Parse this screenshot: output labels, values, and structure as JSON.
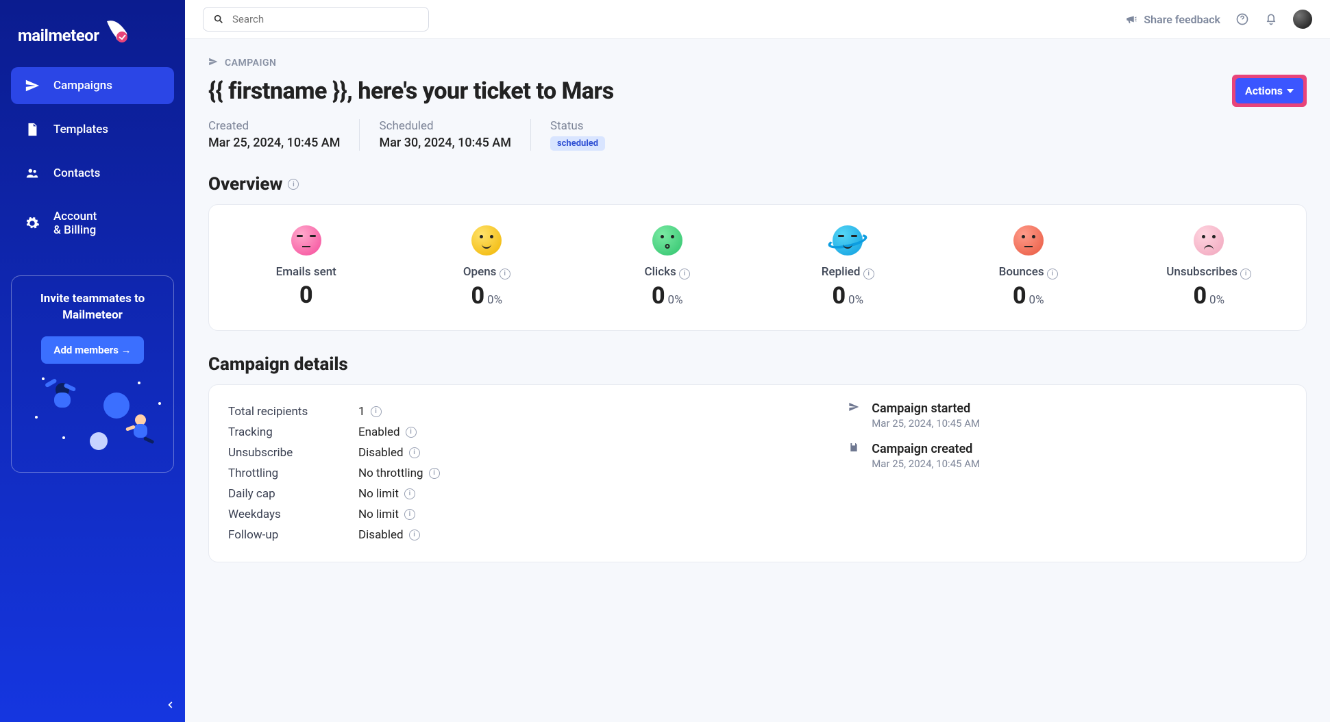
{
  "brand": "mailmeteor",
  "sidebar": {
    "items": [
      {
        "label": "Campaigns"
      },
      {
        "label": "Templates"
      },
      {
        "label": "Contacts"
      },
      {
        "label_l1": "Account",
        "label_l2": "& Billing"
      }
    ],
    "invite": {
      "title_l1": "Invite teammates to",
      "title_l2": "Mailmeteor",
      "cta": "Add members →"
    }
  },
  "topbar": {
    "search_placeholder": "Search",
    "share": "Share feedback"
  },
  "crumb": "CAMPAIGN",
  "title": "{{ firstname }}, here's your ticket to Mars",
  "actions": "Actions",
  "meta": {
    "created": {
      "label": "Created",
      "value": "Mar 25, 2024, 10:45 AM"
    },
    "scheduled": {
      "label": "Scheduled",
      "value": "Mar 30, 2024, 10:45 AM"
    },
    "status": {
      "label": "Status",
      "value": "scheduled"
    }
  },
  "overview": {
    "title": "Overview",
    "stats": [
      {
        "label": "Emails sent",
        "value": "0"
      },
      {
        "label": "Opens",
        "value": "0",
        "pct": "0%"
      },
      {
        "label": "Clicks",
        "value": "0",
        "pct": "0%"
      },
      {
        "label": "Replied",
        "value": "0",
        "pct": "0%"
      },
      {
        "label": "Bounces",
        "value": "0",
        "pct": "0%"
      },
      {
        "label": "Unsubscribes",
        "value": "0",
        "pct": "0%"
      }
    ]
  },
  "details": {
    "title": "Campaign details",
    "rows": [
      {
        "k": "Total recipients",
        "v": "1"
      },
      {
        "k": "Tracking",
        "v": "Enabled"
      },
      {
        "k": "Unsubscribe",
        "v": "Disabled"
      },
      {
        "k": "Throttling",
        "v": "No throttling"
      },
      {
        "k": "Daily cap",
        "v": "No limit"
      },
      {
        "k": "Weekdays",
        "v": "No limit"
      },
      {
        "k": "Follow-up",
        "v": "Disabled"
      }
    ],
    "timeline": [
      {
        "title": "Campaign started",
        "date": "Mar 25, 2024, 10:45 AM"
      },
      {
        "title": "Campaign created",
        "date": "Mar 25, 2024, 10:45 AM"
      }
    ]
  }
}
